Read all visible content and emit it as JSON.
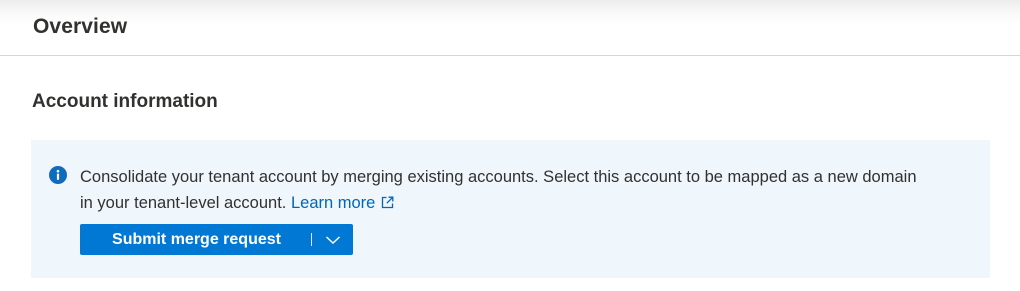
{
  "header": {
    "title": "Overview"
  },
  "section": {
    "title": "Account information"
  },
  "info_bar": {
    "icon": "info-icon",
    "message_line1": "Consolidate your tenant account by merging existing accounts. Select this account to be mapped as a new domain",
    "message_line2": "in your tenant-level account.",
    "learn_more_label": "Learn more",
    "learn_more_icon": "external-link-icon",
    "background_color": "#eff6fc"
  },
  "actions": {
    "primary_label": "Submit merge request",
    "dropdown_icon": "chevron-down-icon",
    "accent_color": "#0078d4"
  }
}
